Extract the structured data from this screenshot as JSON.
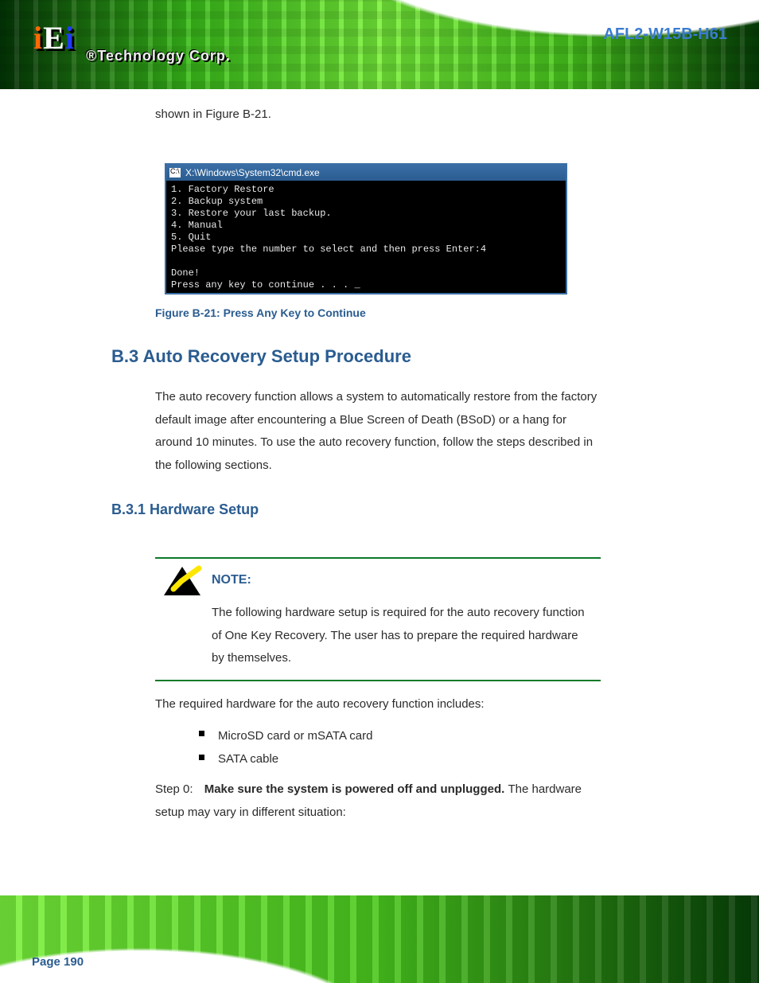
{
  "header": {
    "logo_i1": "i",
    "logo_e": "E",
    "logo_i2": "i",
    "tagline": "®Technology Corp.",
    "product": "AFL2-W15B-H61"
  },
  "intro": "shown in Figure B-21.",
  "cmd": {
    "title": "X:\\Windows\\System32\\cmd.exe",
    "lines": "1. Factory Restore\n2. Backup system\n3. Restore your last backup.\n4. Manual\n5. Quit\nPlease type the number to select and then press Enter:4\n\nDone!\nPress any key to continue . . . _"
  },
  "figcap": "Figure B-21: Press Any Key to Continue",
  "sec1": {
    "num": "B.3",
    "title": "Auto Recovery Setup Procedure"
  },
  "sec1_text": "The auto recovery function allows a system to automatically restore from the factory default image after encountering a Blue Screen of Death (BSoD) or a hang for around 10 minutes. To use the auto recovery function, follow the steps described in the following sections.",
  "sec2": {
    "num": "B.3.1",
    "title": "Hardware Setup"
  },
  "note": {
    "label": "NOTE:",
    "body": "The following hardware setup is required for the auto recovery function of One Key Recovery. The user has to prepare the required hardware by themselves."
  },
  "list_intro": "The required hardware for the auto recovery function includes:",
  "hw": [
    "MicroSD card or mSATA card",
    "SATA cable"
  ],
  "step0": {
    "no": "Step 0:",
    "body_lead": "Make sure the system is powered off and unplugged. ",
    "body_rest": "The hardware setup may vary in different situation:"
  },
  "page_number": "Page 190"
}
